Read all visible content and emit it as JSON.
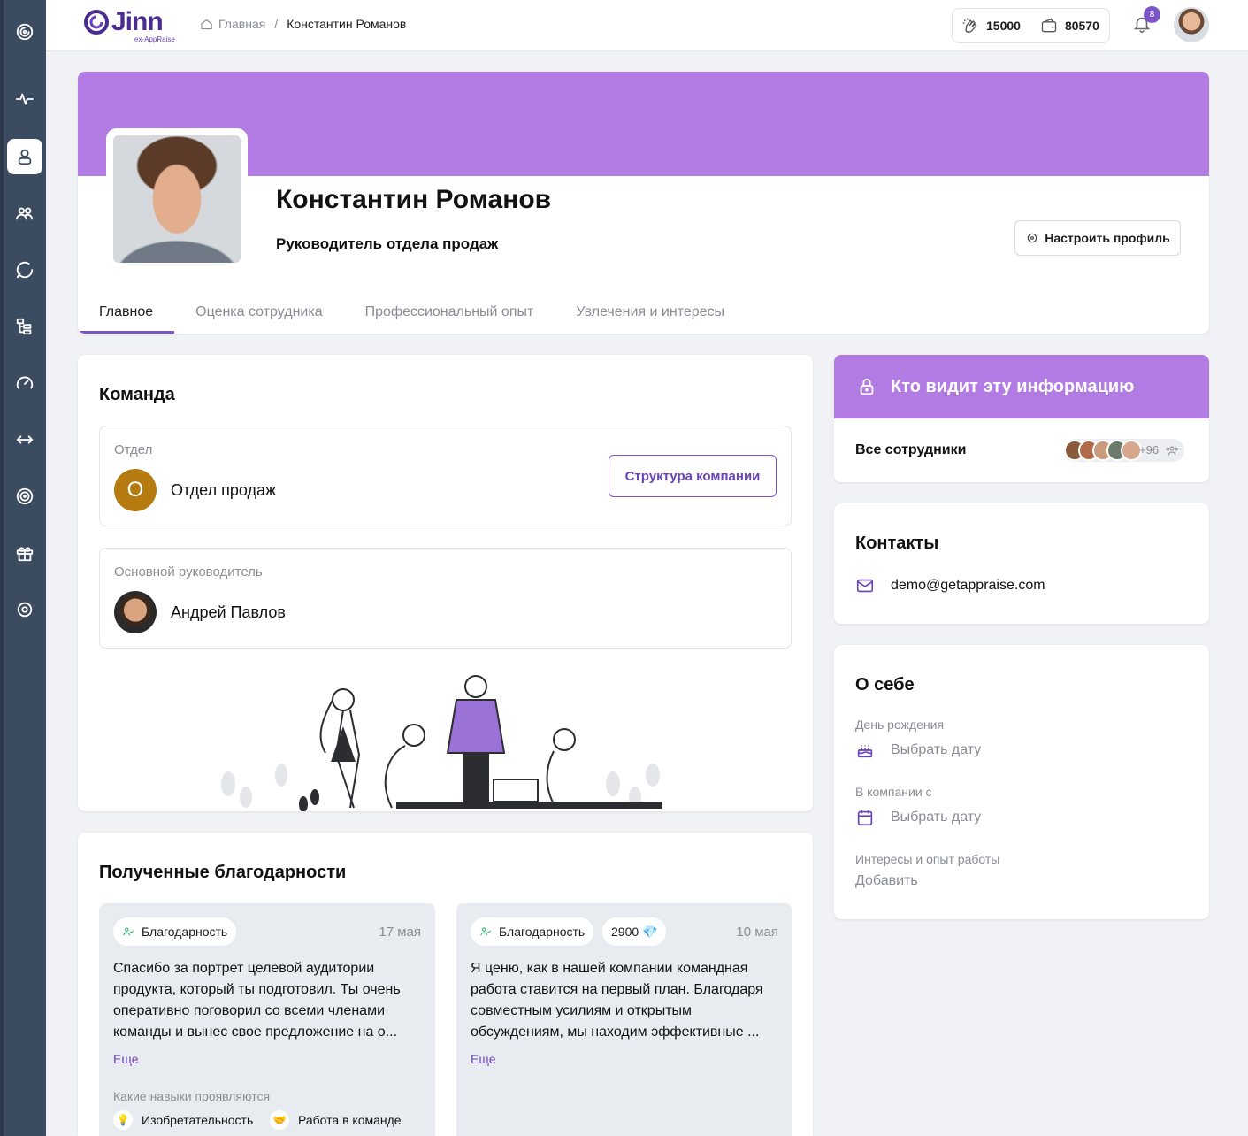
{
  "header": {
    "logo_text": "Jinn",
    "logo_sub": "ex-AppRaise",
    "breadcrumb": {
      "home": "Главная",
      "separator": "/",
      "current": "Константин Романов"
    },
    "wallet": {
      "claps": "15000",
      "balance": "80570"
    },
    "notifications_count": "8"
  },
  "profile": {
    "name": "Константин Романов",
    "role": "Руководитель отдела продаж",
    "settings_button": "Настроить профиль",
    "tabs": [
      {
        "label": "Главное",
        "active": true
      },
      {
        "label": "Оценка сотрудника",
        "active": false
      },
      {
        "label": "Профессиональный опыт",
        "active": false
      },
      {
        "label": "Увлечения и интересы",
        "active": false
      }
    ]
  },
  "team": {
    "title": "Команда",
    "department_label": "Отдел",
    "department_initial": "О",
    "department_name": "Отдел продаж",
    "structure_button": "Структура компании",
    "manager_label": "Основной руководитель",
    "manager_name": "Андрей Павлов"
  },
  "thanks": {
    "title": "Полученные благодарности",
    "items": [
      {
        "chip": "Благодарность",
        "date": "17 мая",
        "text": "Спасибо за портрет целевой аудитории продукта, который ты подготовил. Ты очень оперативно поговорил со всеми членами команды и вынес свое предложение на о...",
        "more": "Еще",
        "skills_label": "Какие навыки проявляются",
        "skills": [
          {
            "emoji": "💡",
            "label": "Изобретательность"
          },
          {
            "emoji": "🤝",
            "label": "Работа в команде"
          }
        ]
      },
      {
        "chip": "Благодарность",
        "points": "2900 💎",
        "date": "10 мая",
        "text": "Я ценю, как в нашей компании командная работа ставится на первый план. Благодаря совместным усилиям и открытым обсуждениям, мы находим эффективные ...",
        "more": "Еще"
      }
    ]
  },
  "visibility": {
    "title": "Кто видит эту информацию",
    "audience": "Все сотрудники",
    "extra_count": "+96"
  },
  "contacts": {
    "title": "Контакты",
    "email": "demo@getappraise.com"
  },
  "about": {
    "title": "О себе",
    "birthday_label": "День рождения",
    "birthday_value": "Выбрать дату",
    "joined_label": "В компании с",
    "joined_value": "Выбрать дату",
    "interests_label": "Интересы и опыт работы",
    "interests_value": "Добавить"
  },
  "colors": {
    "accent": "#b17be3",
    "accent_dark": "#7b55c7",
    "sidebar": "#3b4b60",
    "department": "#b57a10"
  }
}
